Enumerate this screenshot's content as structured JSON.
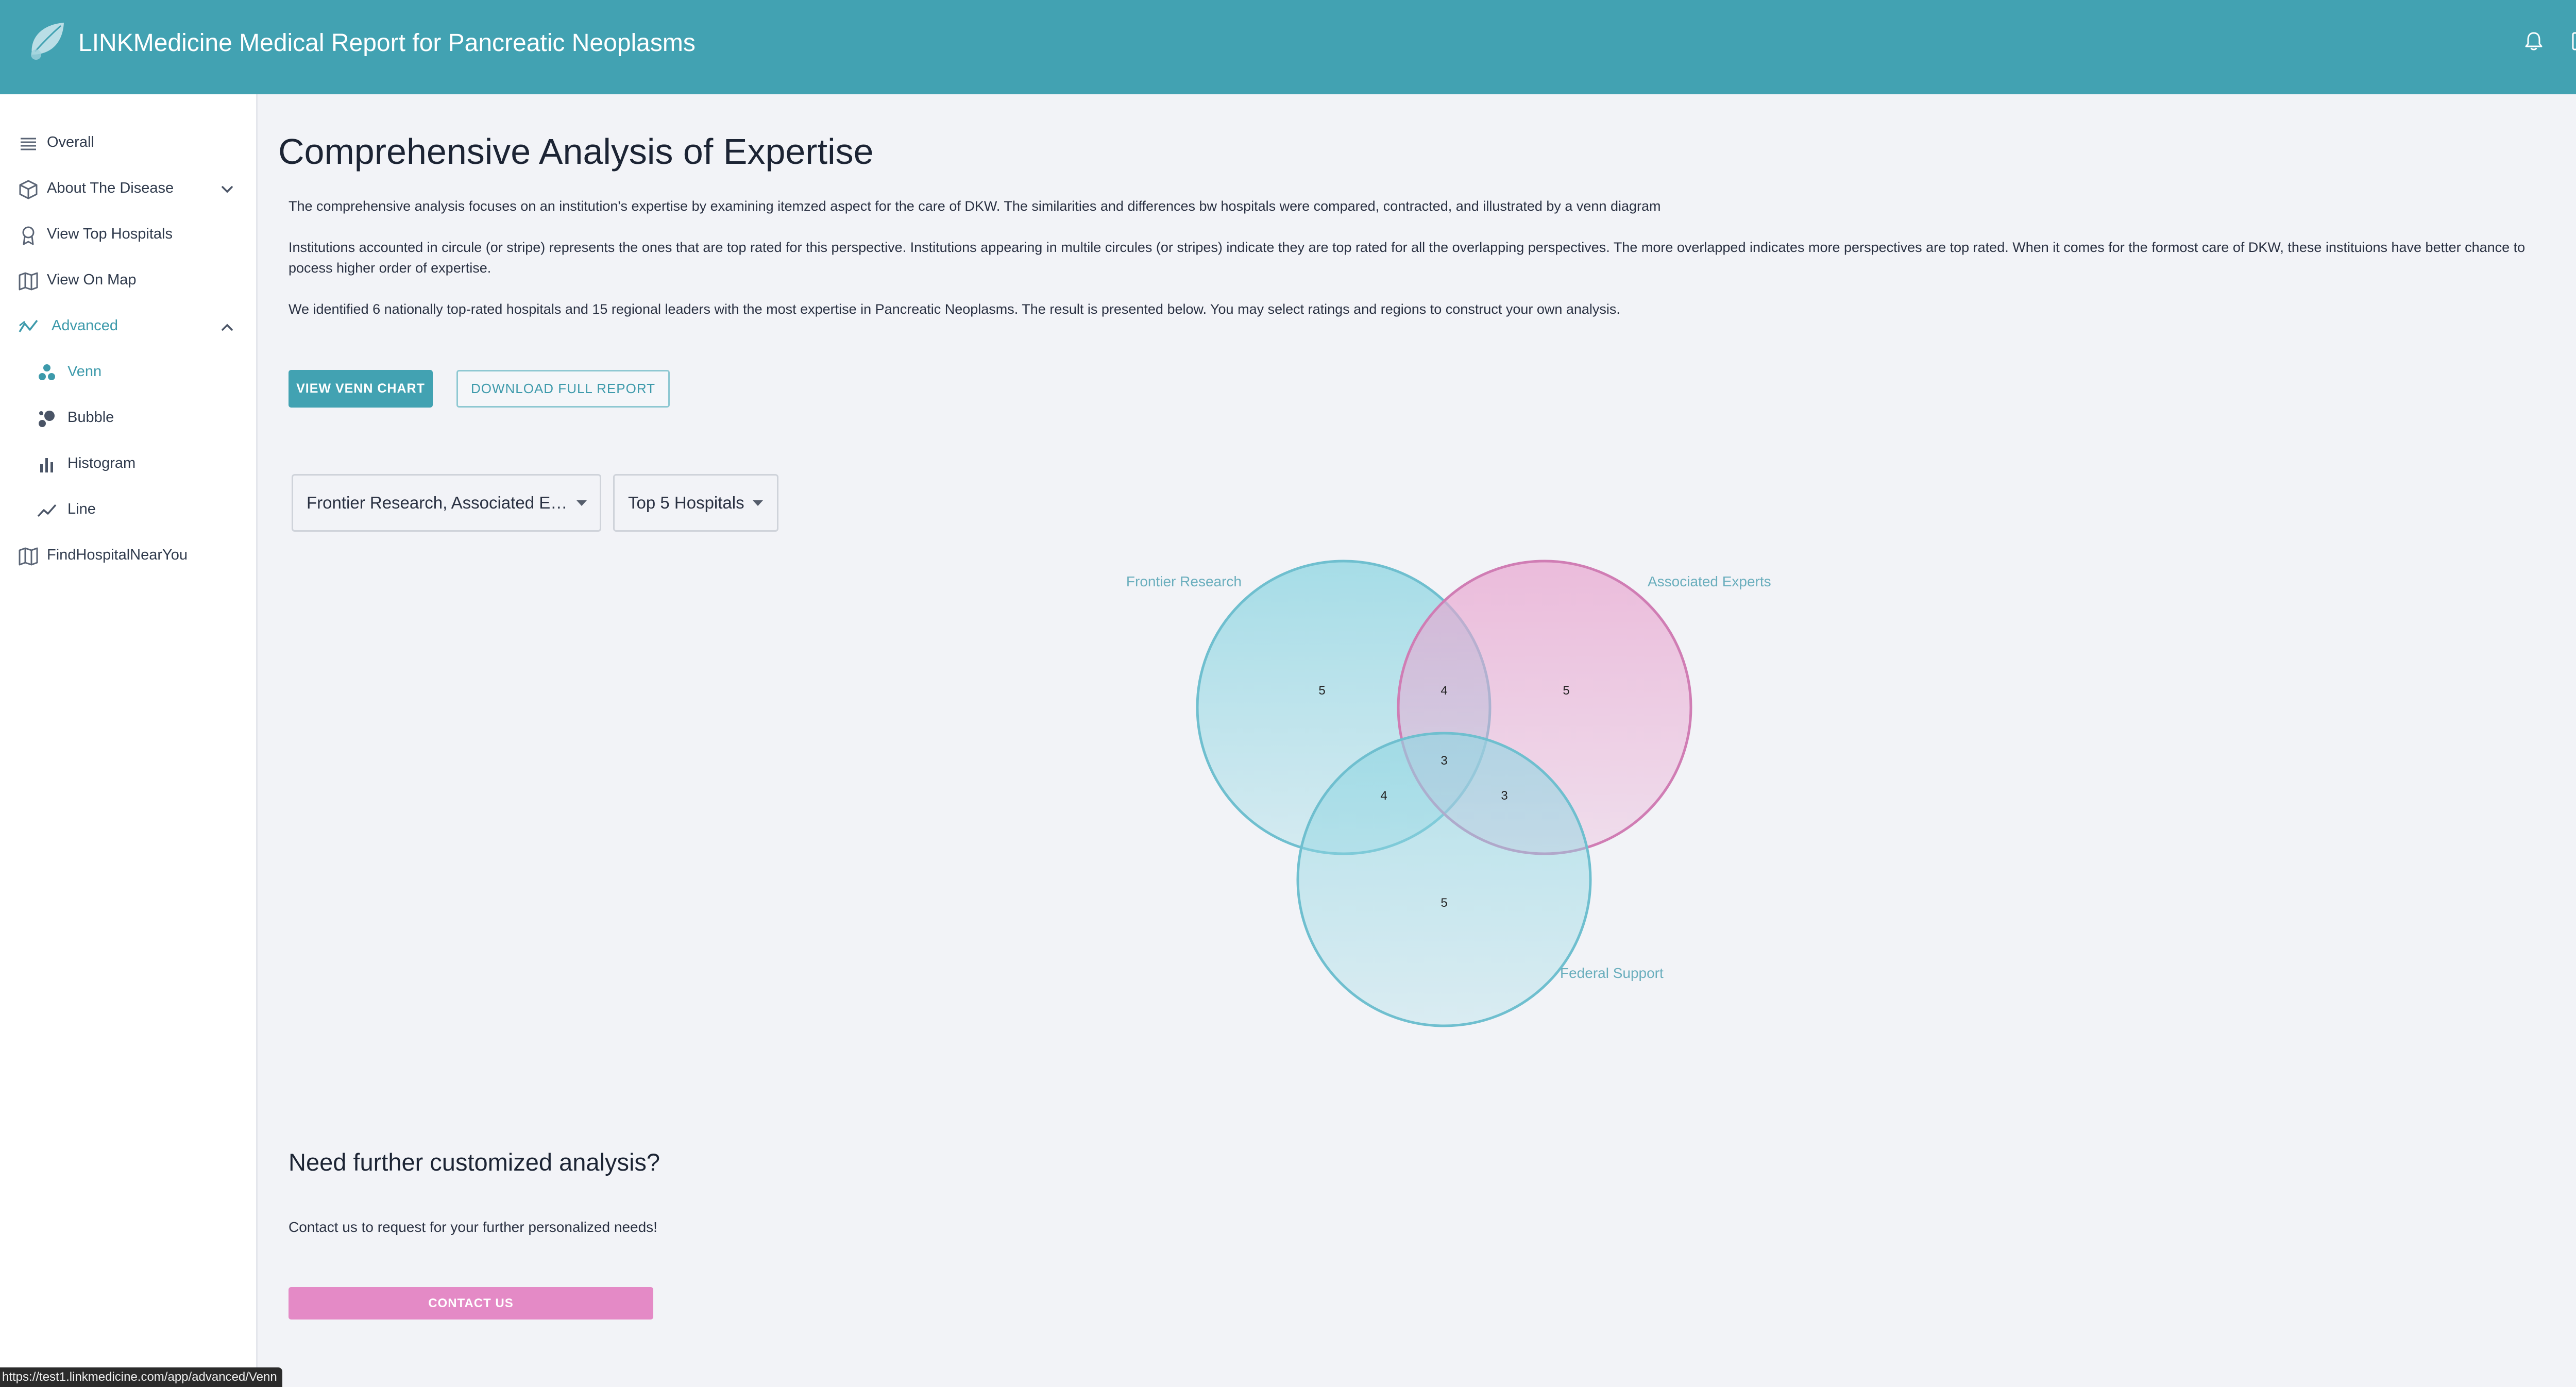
{
  "header": {
    "title": "LINKMedicine Medical Report for Pancreatic Neoplasms",
    "logo_icon": "leaf-logo-icon",
    "notifications_icon": "bell-icon",
    "logout_icon": "logout-icon"
  },
  "sidebar": {
    "items": [
      {
        "label": "Overall",
        "icon": "list-icon"
      },
      {
        "label": "About The Disease",
        "icon": "cube-icon",
        "expandable": true,
        "expanded": false
      },
      {
        "label": "View Top Hospitals",
        "icon": "award-icon"
      },
      {
        "label": "View On Map",
        "icon": "map-icon"
      },
      {
        "label": "Advanced",
        "icon": "trend-icon",
        "expandable": true,
        "expanded": true,
        "active": true
      },
      {
        "label": "Venn",
        "icon": "venn-icon",
        "active": true
      },
      {
        "label": "Bubble",
        "icon": "bubble-icon"
      },
      {
        "label": "Histogram",
        "icon": "bar-chart-icon"
      },
      {
        "label": "Line",
        "icon": "line-chart-icon"
      },
      {
        "label": "FindHospitalNearYou",
        "icon": "map-icon"
      }
    ]
  },
  "main": {
    "title": "Comprehensive Analysis of Expertise",
    "paragraphs": [
      "The comprehensive analysis focuses on an institution's expertise by examining itemzed aspect for the care of DKW. The similarities and differences bw hospitals were compared, contracted, and illustrated by a venn diagram",
      "Institutions accounted in circule (or stripe) represents the ones that are top rated for this perspective. Institutions appearing in multile circules (or stripes) indicate they are top rated for all the overlapping perspectives. The more overlapped indicates more perspectives are top rated. When it comes for the formost care of DKW, these instituions have better chance to pocess higher order of expertise.",
      "We identified 6 nationally top-rated hospitals and 15 regional leaders with the most expertise in Pancreatic Neoplasms. The result is presented below. You may select ratings and regions to construct your own analysis."
    ],
    "view_venn_button": "View Venn Chart",
    "download_button": "Download Full Report",
    "filter_select": "Frontier Research, Associated Ex...",
    "top_select": "Top 5 Hospitals"
  },
  "venn": {
    "sets": [
      {
        "name": "Frontier Research",
        "color": "#8fd6e2"
      },
      {
        "name": "Associated Experts",
        "color": "#e8a6d0"
      },
      {
        "name": "Federal Support",
        "color": "#8fd6e2"
      }
    ],
    "region_counts": {
      "only_frontier": "5",
      "only_associated": "5",
      "only_federal": "5",
      "frontier_associated": "4",
      "frontier_federal": "4",
      "associated_federal": "3",
      "all_three": "3"
    }
  },
  "contact": {
    "title": "Need further customized analysis?",
    "text": "Contact us to request for your further personalized needs!",
    "button": "Contact Us"
  },
  "status_bar": {
    "url": "https://test1.linkmedicine.com/app/advanced/Venn"
  },
  "colors": {
    "header": "#42a2b2",
    "accent": "#3d9aab",
    "contact_button": "#e48ac6",
    "venn_teal": "#8fd6e2",
    "venn_pink": "#e8a6d0"
  }
}
